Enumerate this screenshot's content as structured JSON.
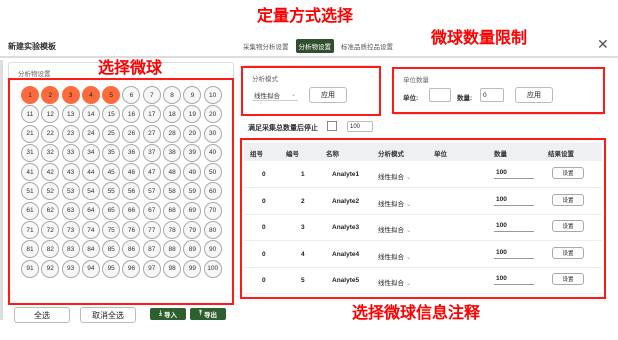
{
  "annotations": {
    "quant_mode": "定量方式选择",
    "bead_limit": "微球数量限制",
    "select_beads": "选择微球",
    "bead_info": "选择微球信息注释"
  },
  "window": {
    "title": "新建实验模板",
    "tabs": [
      "采集物分析设置",
      "分析物设置",
      "标准品质控品设置"
    ],
    "active_tab": 1
  },
  "bead_panel": {
    "title": "分析物设置",
    "selected": [
      1,
      2,
      3,
      4,
      5
    ],
    "select_all": "全选",
    "deselect_all": "取消全选",
    "import": "导入",
    "export": "导出",
    "selected_color": "#ff6b3d"
  },
  "mode_panel": {
    "title": "分析模式",
    "mode_value": "线性拟合",
    "apply": "应用"
  },
  "unit_panel": {
    "title": "单位数量",
    "unit_label": "单位:",
    "count_label": "数量:",
    "count_value": "0",
    "apply": "应用"
  },
  "stop_option": {
    "label": "满足采集总数量后停止",
    "value": "100"
  },
  "table": {
    "headers": [
      "组号",
      "编号",
      "名称",
      "分析模式",
      "单位",
      "数量",
      "结果设置"
    ],
    "rows": [
      {
        "group": "0",
        "id": "1",
        "name": "Analyte1",
        "mode": "线性拟合",
        "unit": "",
        "count": "100",
        "action": "设置"
      },
      {
        "group": "0",
        "id": "2",
        "name": "Analyte2",
        "mode": "线性拟合",
        "unit": "",
        "count": "100",
        "action": "设置"
      },
      {
        "group": "0",
        "id": "3",
        "name": "Analyte3",
        "mode": "线性拟合",
        "unit": "",
        "count": "100",
        "action": "设置"
      },
      {
        "group": "0",
        "id": "4",
        "name": "Analyte4",
        "mode": "线性拟合",
        "unit": "",
        "count": "100",
        "action": "设置"
      },
      {
        "group": "0",
        "id": "5",
        "name": "Analyte5",
        "mode": "线性拟合",
        "unit": "",
        "count": "100",
        "action": "设置"
      }
    ]
  }
}
